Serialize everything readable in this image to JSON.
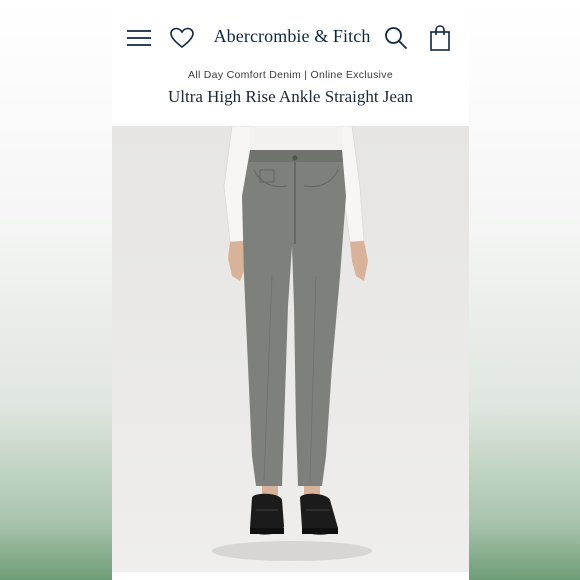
{
  "header": {
    "brand": "Abercrombie & Fitch",
    "icons": [
      "menu-icon",
      "heart-icon",
      "search-icon",
      "shopping-bag-icon"
    ]
  },
  "product": {
    "collection_line": "All Day Comfort Denim | Online Exclusive",
    "title": "Ultra High Rise Ankle Straight Jean"
  },
  "colors": {
    "brand_navy": "#0f2740",
    "denim_gray": "#7d807b",
    "background_green": "#6f9d78"
  }
}
